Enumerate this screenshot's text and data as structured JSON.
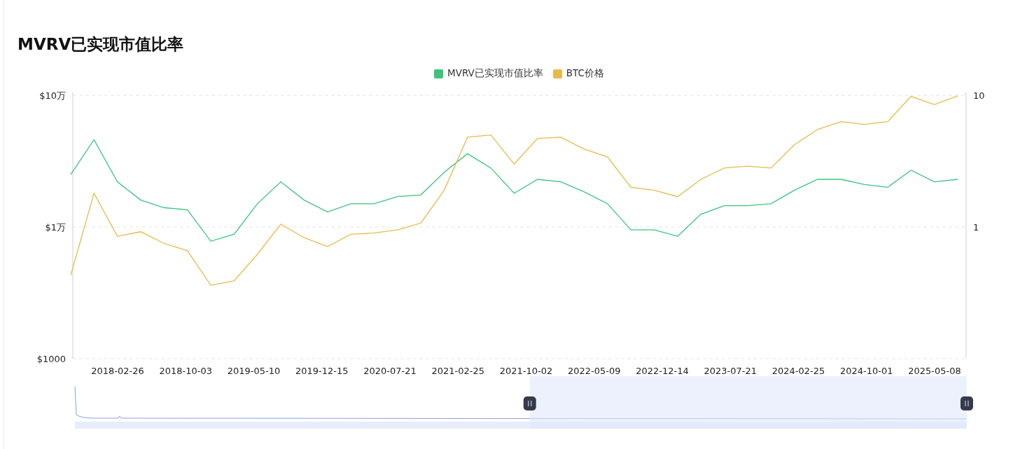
{
  "title": "MVRV已实现市值比率",
  "chart": {
    "legend": [
      {
        "name": "MVRV已实现市值比率",
        "color": "#3cc47c"
      },
      {
        "name": "BTC价格",
        "color": "#e9b949"
      }
    ],
    "x_labels": [
      "2018-02-26",
      "2018-10-03",
      "2019-05-10",
      "2019-12-15",
      "2020-07-21",
      "2021-02-25",
      "2021-10-02",
      "2022-05-09",
      "2022-12-14",
      "2023-07-21",
      "2024-02-25",
      "2024-10-01",
      "2025-05-08"
    ],
    "left_axis": {
      "labels": [
        "$10万",
        "$1万",
        "$1000"
      ]
    },
    "right_axis": {
      "labels": [
        "10",
        "1"
      ]
    },
    "navigator": {
      "level": 0.49
    }
  }
}
